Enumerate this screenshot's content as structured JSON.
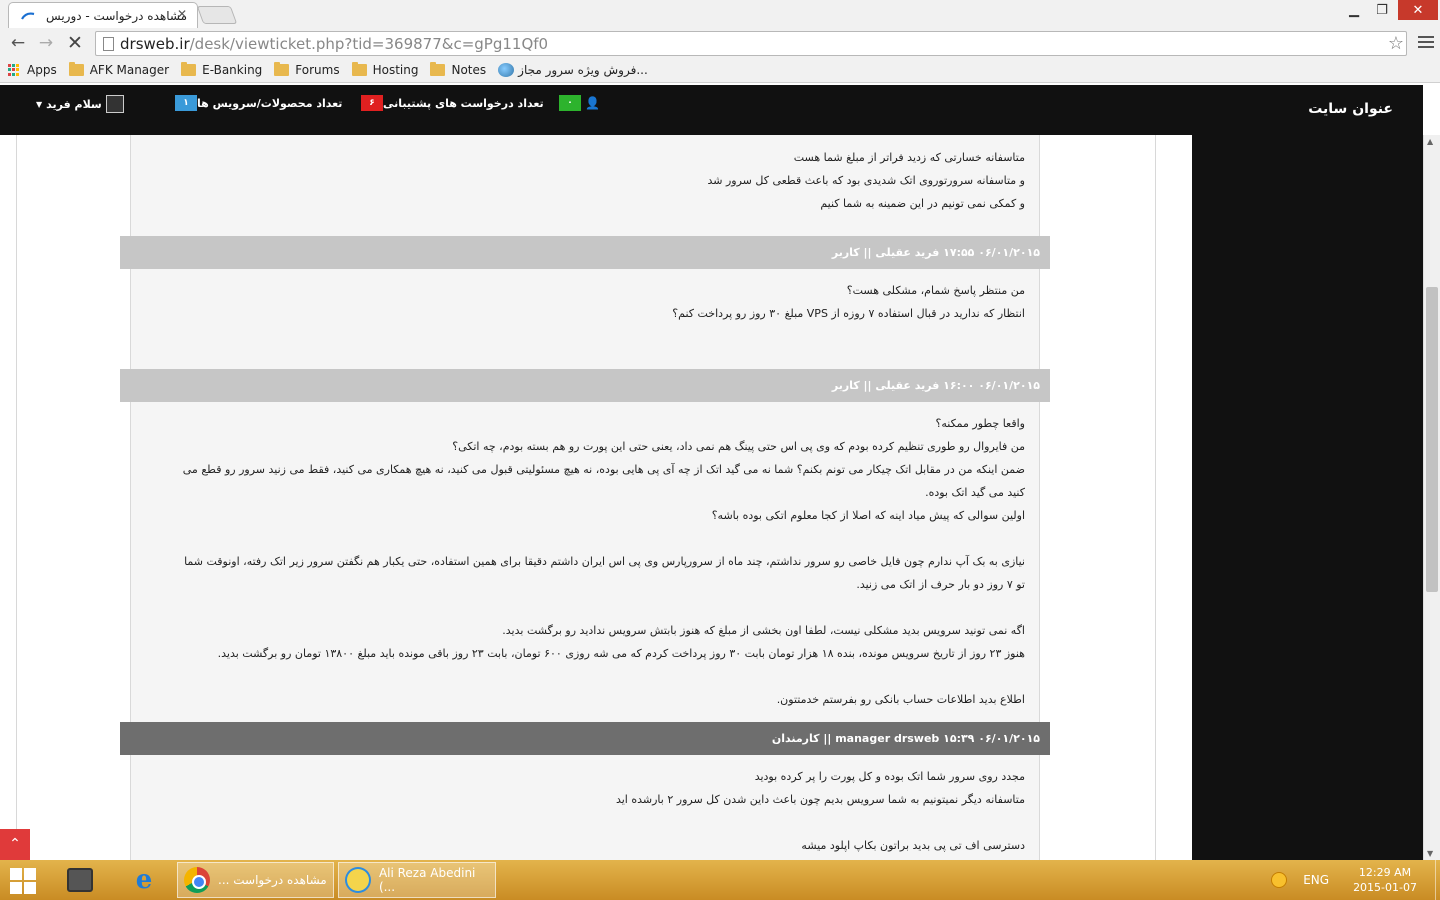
{
  "browser": {
    "tab_title": "مشاهده درخواست - دوریس",
    "tab_close": "✕",
    "url_host": "drsweb.ir",
    "url_path": "/desk/viewticket.php?tid=369877&c=gPg11Qf0",
    "window": {
      "minimize": "▁",
      "maximize": "❐",
      "close": "✕"
    }
  },
  "bookmarks": [
    {
      "label": "Apps",
      "icon": "apps-grid-icon"
    },
    {
      "label": "AFK Manager",
      "icon": "folder-icon"
    },
    {
      "label": "E-Banking",
      "icon": "folder-icon"
    },
    {
      "label": "Forums",
      "icon": "folder-icon"
    },
    {
      "label": "Hosting",
      "icon": "folder-icon"
    },
    {
      "label": "Notes",
      "icon": "folder-icon"
    },
    {
      "label": "فروش ویژه سرور مجاز...",
      "icon": "globe-icon"
    }
  ],
  "header": {
    "site_title": "عنوان سایت",
    "user_count": "۰",
    "tickets_label": "تعداد درخواست های پشتیبانی",
    "tickets_count": "۶",
    "services_label": "تعداد محصولات/سرویس ها",
    "services_count": "۱",
    "greeting": "سلام فرید",
    "colors": {
      "green": "#2db32d",
      "red": "#e02020",
      "blue": "#3a9ad9",
      "header_bg": "#111111"
    }
  },
  "thread": {
    "msg0_lines": [
      "متاسفانه خسارتی که زدید فراتر از مبلغ شما هست",
      "و متاسفانه سرورتوروی اتک شدیدی بود که باعث قطعی کل سرور شد",
      "و کمکی نمی تونیم در این ضمینه به شما کنیم"
    ],
    "msg1_head": "۰۶/۰۱/۲۰۱۵ ۱۷:۵۵ فرید عقیلی || کاربر",
    "msg1_lines": [
      "من منتظر پاسخ شمام، مشکلی هست؟",
      "انتظار که ندارید در قبال استفاده ۷ روزه از VPS مبلغ ۳۰ روز رو پرداخت کنم؟",
      ""
    ],
    "msg2_head": "۰۶/۰۱/۲۰۱۵ ۱۶:۰۰ فرید عقیلی || کاربر",
    "msg2_lines": [
      "واقعا چطور ممکنه؟",
      "من فایروال رو طوری تنظیم کرده بودم که وی پی اس حتی پینگ هم نمی داد، یعنی حتی این پورت رو هم بسته بودم، چه اتکی؟",
      "ضمن اینکه من در مقابل اتک چیکار می تونم بکنم؟ شما نه می گید اتک از چه آی پی هایی بوده، نه هیچ مسئولیتی قبول می کنید، نه هیچ همکاری می کنید، فقط می زنید سرور رو قطع می",
      "کنید می گید اتک بوده.",
      "اولین سوالی که پیش میاد اینه که اصلا از کجا معلوم اتکی بوده باشه؟",
      "",
      "نیازی به بک آپ ندارم چون فایل خاصی رو سرور نداشتم، چند ماه از سرورپارس وی پی اس ایران داشتم دقیقا برای همین استفاده، حتی یکبار هم نگفتن سرور زیر اتک رفته، اونوقت شما",
      "تو ۷ روز دو بار حرف از اتک می زنید.",
      "",
      "اگه نمی تونید سرویس بدید مشکلی نیست، لطفا اون بخشی از مبلغ که هنوز بابتش سرویس ندادید رو برگشت بدید.",
      "هنوز ۲۳ روز از تاریخ سرویس مونده، بنده ۱۸ هزار تومان بابت ۳۰ روز پرداخت کردم که می شه روزی ۶۰۰ تومان، بابت ۲۳ روز باقی مونده باید مبلغ ۱۳۸۰۰ تومان رو برگشت بدید.",
      "",
      "اطلاع بدید اطلاعات حساب بانکی رو بفرستم خدمتتون."
    ],
    "msg3_head": "۰۶/۰۱/۲۰۱۵ ۱۵:۳۹ manager drsweb || کارمندان",
    "msg3_lines": [
      "مجدد روی سرور شما اتک بوده و کل پورت را پر کرده بودید",
      "متاسفانه دیگر نمیتونیم به شما سرویس بدیم چون باعث داین شدن کل سرور ۲ بارشده اید",
      "",
      "دسترسی اف تی پی بدید براتون بکاپ اپلود میشه"
    ]
  },
  "taskbar": {
    "chrome_task": "مشاهده درخواست ...",
    "skype_task": "Ali Reza Abedini (...",
    "lang": "ENG",
    "time": "12:29 AM",
    "date": "2015-01-07"
  },
  "scroll_to_top": "⌃"
}
